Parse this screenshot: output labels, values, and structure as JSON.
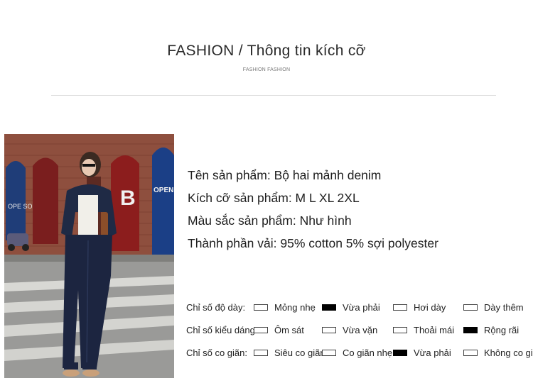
{
  "header": {
    "title": "FASHION / Thông tin kích cỡ",
    "subtitle": "FASHION FASHION"
  },
  "product": {
    "name": "Tên sản phẩm: Bộ hai mảnh denim",
    "sizes": "Kích cỡ sản phẩm: M  L  XL  2XL",
    "color": "Màu sắc sản phẩm: Như hình",
    "fabric": "Thành phần vải: 95% cotton 5% sợi polyester"
  },
  "photo_signs": {
    "sign_left": "OPE SO",
    "sign_b": "B",
    "sign_right": "OPEN SOO"
  },
  "specs": [
    {
      "label": "Chỉ số độ dày:",
      "options": [
        {
          "text": "Mỏng nhẹ",
          "selected": false
        },
        {
          "text": "Vừa phải",
          "selected": true
        },
        {
          "text": "Hơi dày",
          "selected": false
        },
        {
          "text": "Dày thêm",
          "selected": false
        }
      ]
    },
    {
      "label": "Chỉ số kiểu dáng:",
      "options": [
        {
          "text": "Ôm sát",
          "selected": false
        },
        {
          "text": "Vừa vặn",
          "selected": false
        },
        {
          "text": "Thoải mái",
          "selected": false
        },
        {
          "text": "Rộng rãi",
          "selected": true
        }
      ]
    },
    {
      "label": "Chỉ số co giãn:",
      "options": [
        {
          "text": "Siêu co giãn",
          "selected": false
        },
        {
          "text": "Co giãn nhẹ",
          "selected": false
        },
        {
          "text": "Vừa phải",
          "selected": true
        },
        {
          "text": "Không co giãn",
          "selected": false
        }
      ]
    }
  ]
}
